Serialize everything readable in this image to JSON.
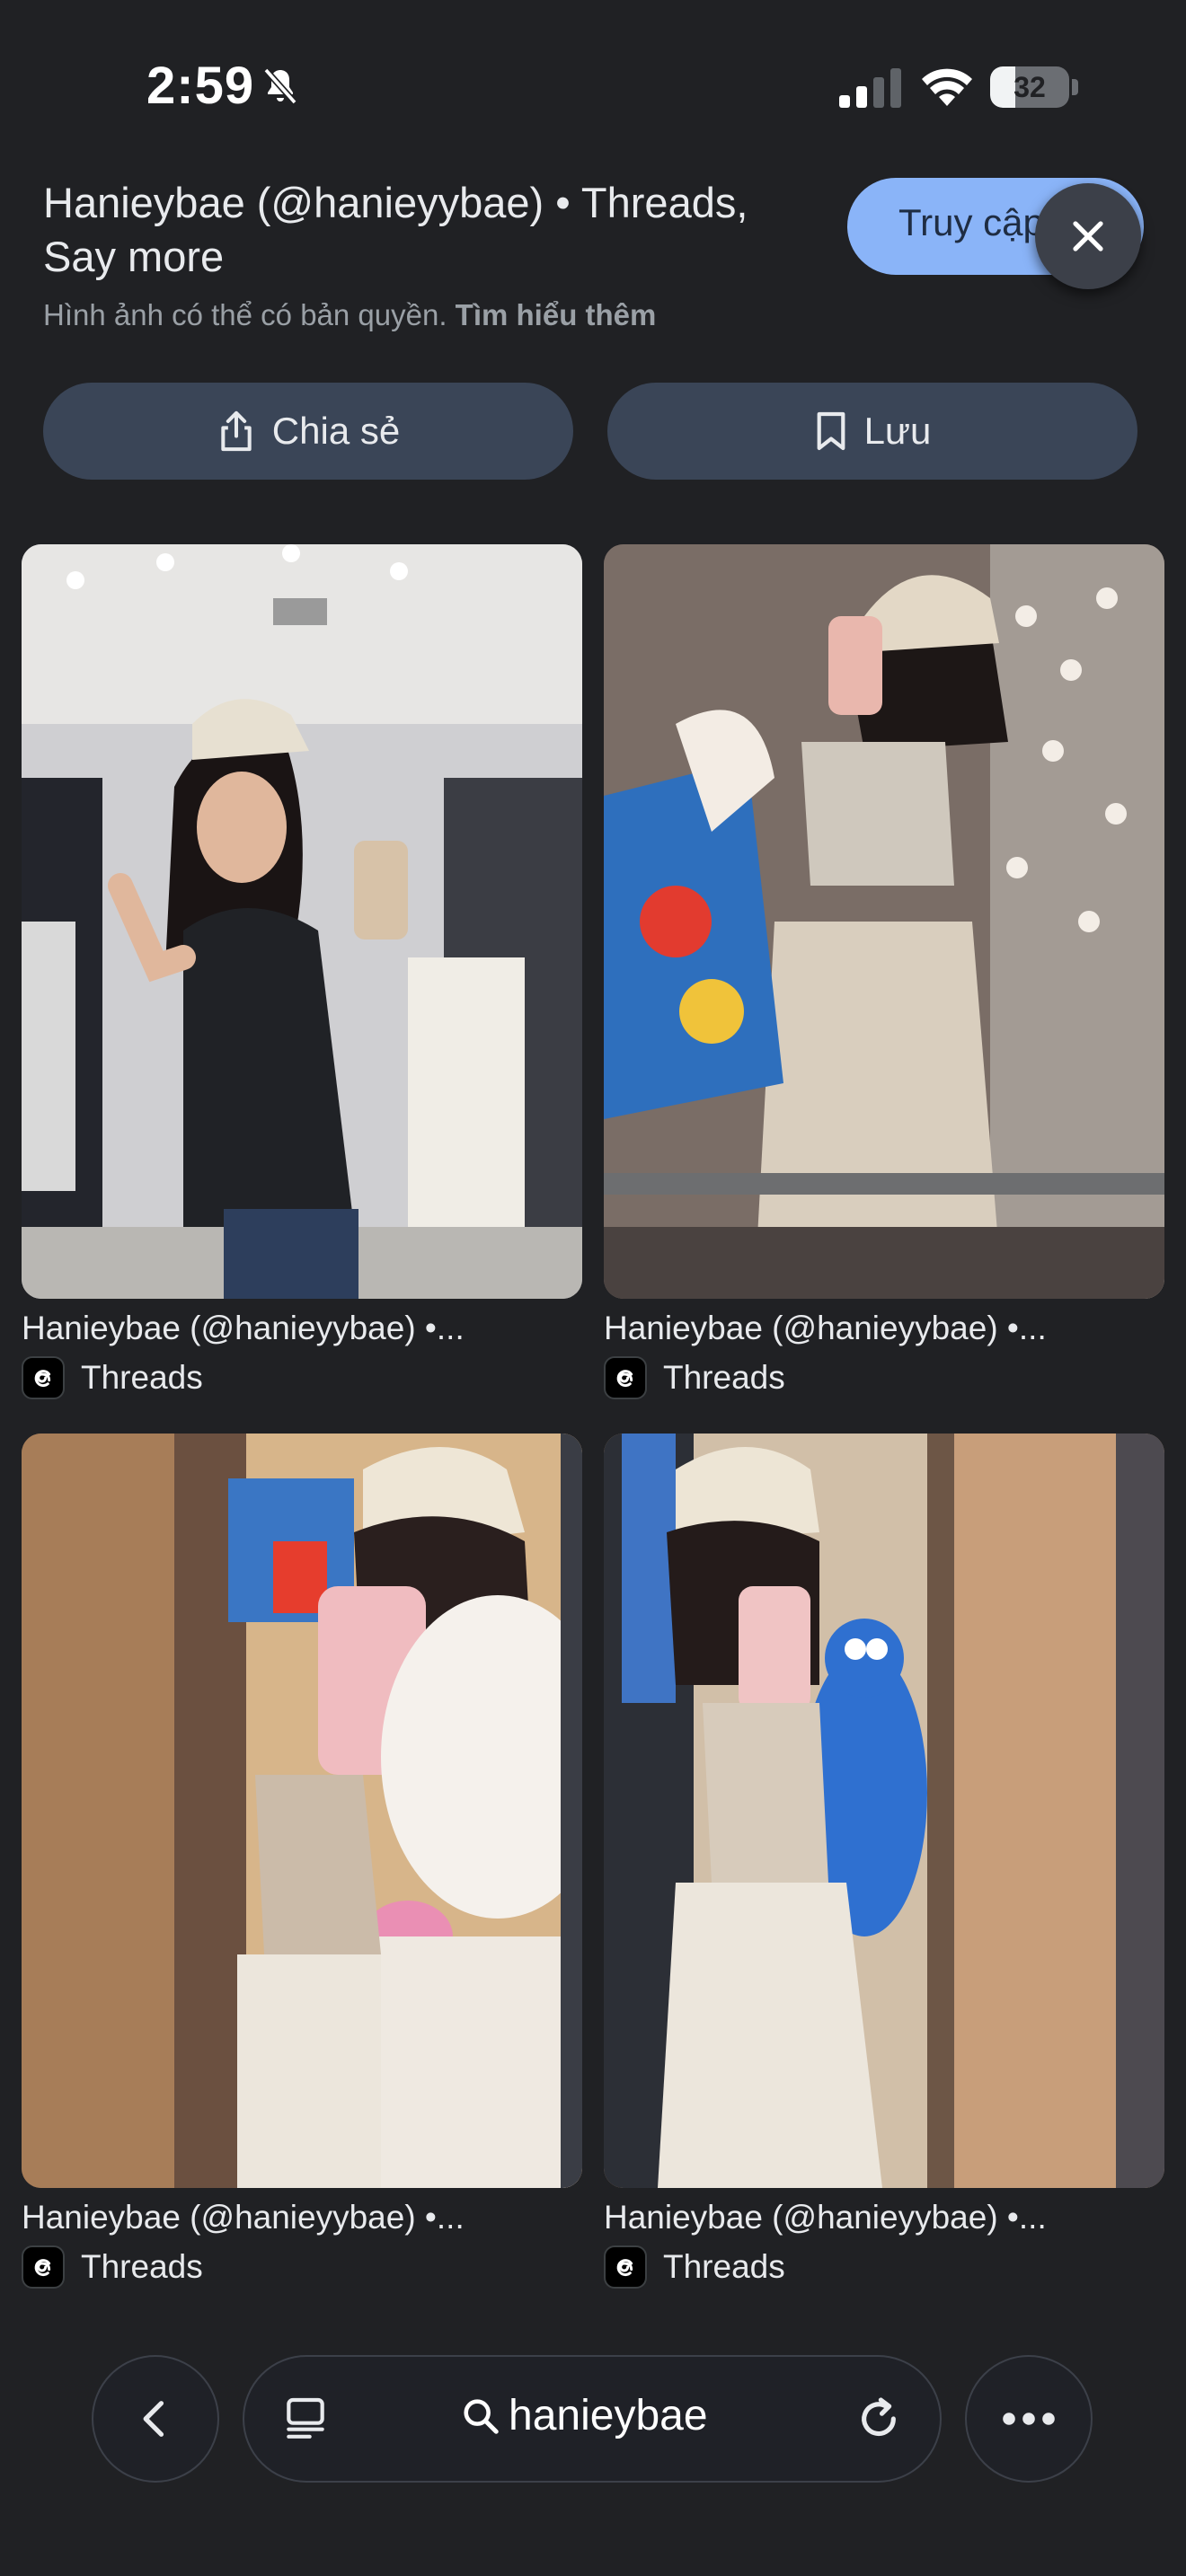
{
  "status_bar": {
    "time": "2:59",
    "battery_percent": "32",
    "battery_level": 0.32,
    "icons": [
      "bell-slash-icon",
      "cellular-signal-icon",
      "wifi-icon",
      "battery-icon"
    ]
  },
  "header": {
    "title": "Hanieybae (@hanieyybae) • Threads, Say more",
    "copyright_text": "Hình ảnh có thể có bản quyền.",
    "learn_more": "Tìm hiểu thêm",
    "visit_button": "Truy cập",
    "close_icon": "close-icon"
  },
  "actions": {
    "share": "Chia sẻ",
    "share_icon": "share-icon",
    "save": "Lưu",
    "save_icon": "bookmark-icon"
  },
  "results": [
    {
      "title": "Hanieybae (@hanieyybae) •...",
      "source": "Threads"
    },
    {
      "title": "Hanieybae (@hanieyybae) •...",
      "source": "Threads"
    },
    {
      "title": "Hanieybae (@hanieyybae) •...",
      "source": "Threads"
    },
    {
      "title": "Hanieybae (@hanieyybae) •...",
      "source": "Threads"
    }
  ],
  "bottom_bar": {
    "query": "hanieybae",
    "icons": [
      "back-icon",
      "tabs-icon",
      "search-icon",
      "reload-icon",
      "more-icon"
    ]
  }
}
